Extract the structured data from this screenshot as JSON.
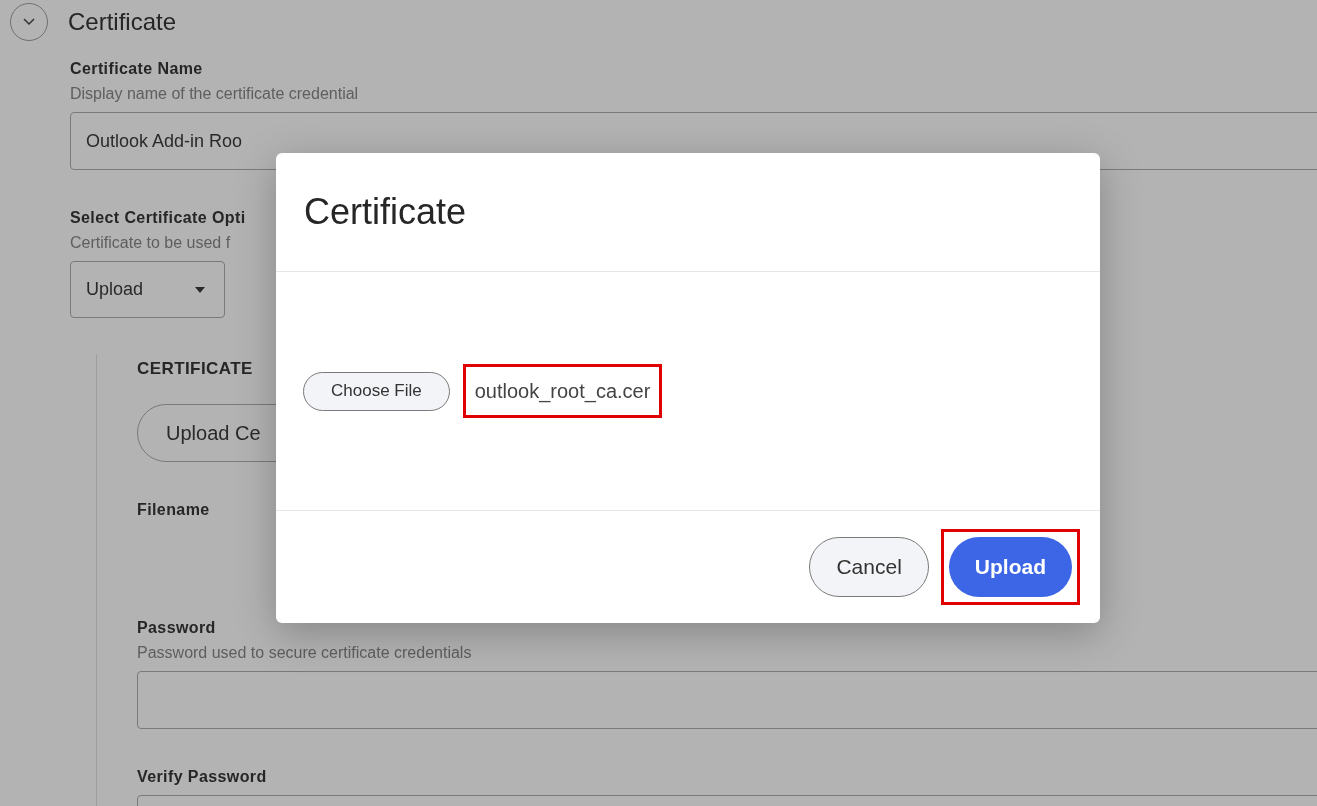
{
  "section": {
    "title": "Certificate",
    "expanded": true
  },
  "fields": [
    {
      "kind": "text",
      "label": "Certificate Name",
      "hint": "Display name of the certificate credential",
      "value": "Outlook Add-in Roo"
    },
    {
      "kind": "select",
      "label": "Select Certificate Opti",
      "hint": "Certificate to be used f",
      "value": "Upload"
    }
  ],
  "certificate_group": {
    "heading": "CERTIFICATE",
    "upload_button": "Upload Ce",
    "fields": [
      {
        "kind": "label",
        "label": "Filename"
      },
      {
        "kind": "password",
        "label": "Password",
        "hint": "Password used to secure certificate credentials"
      },
      {
        "kind": "password",
        "label": "Verify Password"
      }
    ]
  },
  "dialog": {
    "title": "Certificate",
    "choose_button": "Choose File",
    "file_name": "outlook_root_ca.cer",
    "file_highlighted": true,
    "buttons": [
      {
        "label": "Cancel",
        "kind": "secondary",
        "highlighted": false
      },
      {
        "label": "Upload",
        "kind": "primary",
        "highlighted": true
      }
    ]
  }
}
